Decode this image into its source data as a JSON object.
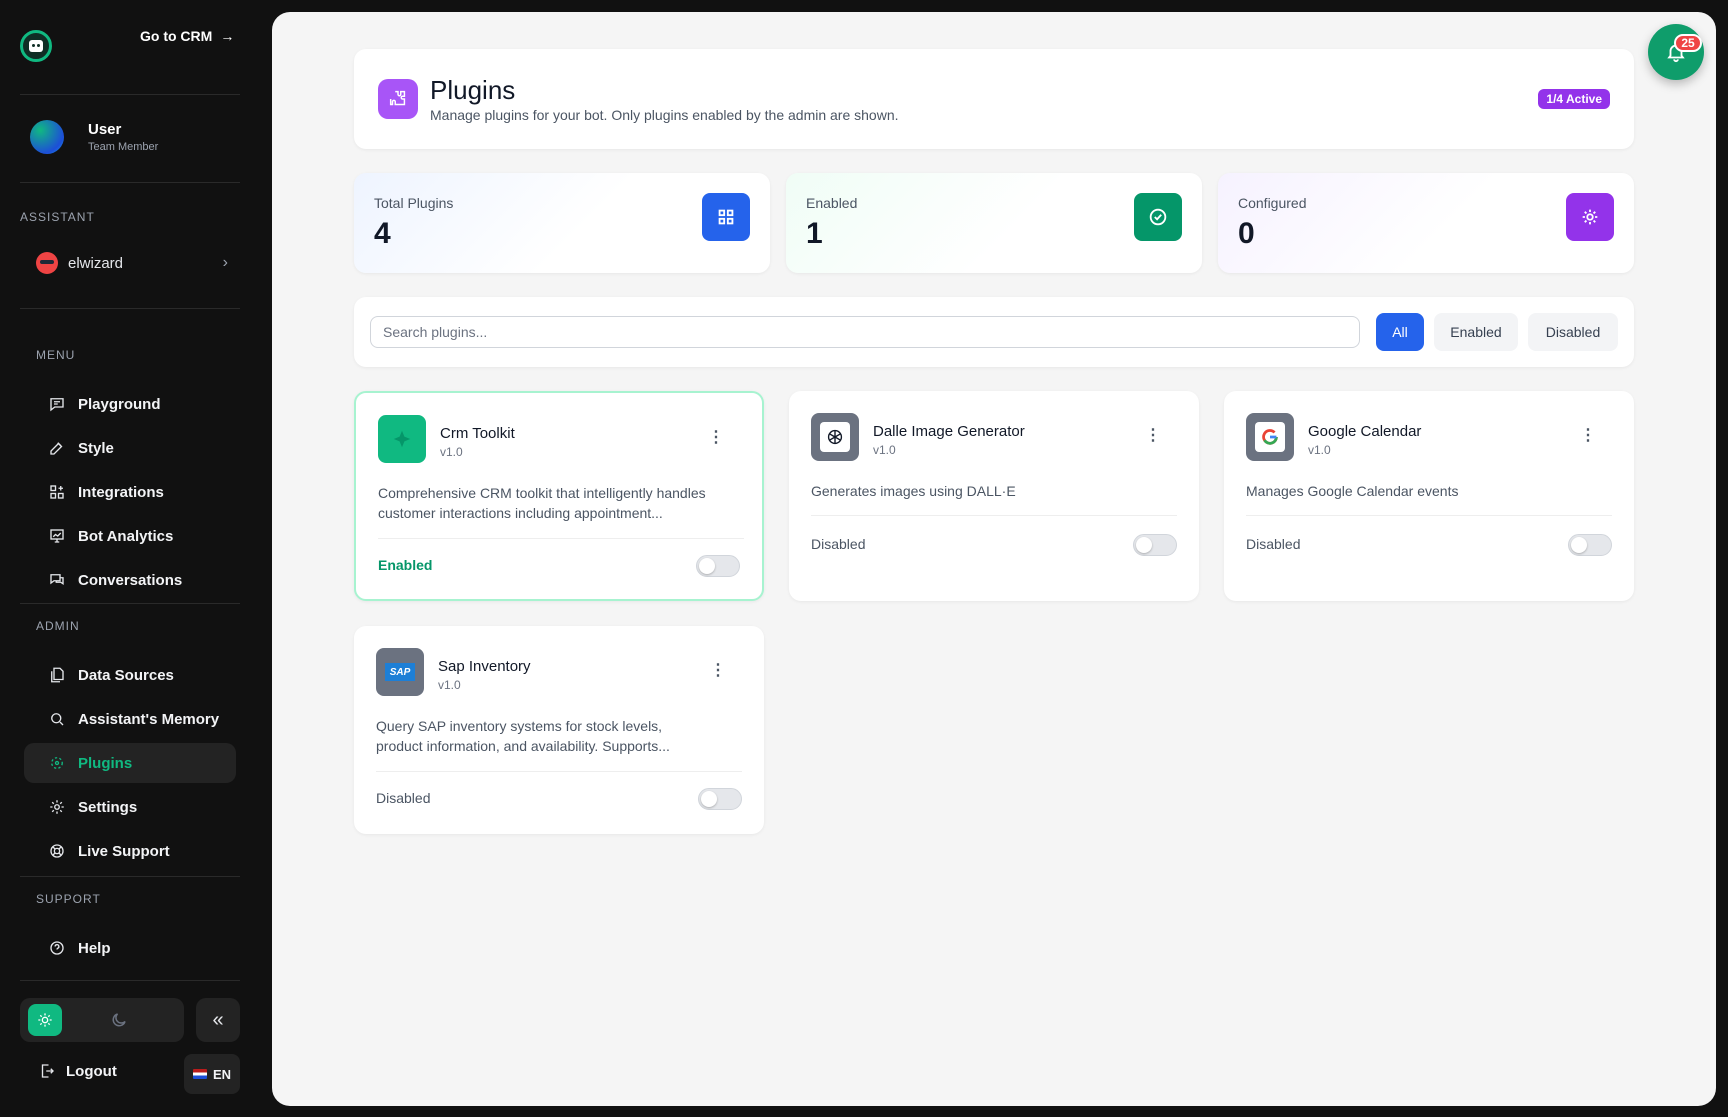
{
  "sidebar": {
    "goto_crm": "Go to CRM",
    "user": {
      "name": "User",
      "role": "Team Member"
    },
    "assistant_section": "ASSISTANT",
    "assistant_name": "elwizard",
    "menu_section": "MENU",
    "menu": [
      {
        "label": "Playground",
        "icon": "chat-bubble-icon"
      },
      {
        "label": "Style",
        "icon": "edit-icon"
      },
      {
        "label": "Integrations",
        "icon": "grid-plus-icon"
      },
      {
        "label": "Bot Analytics",
        "icon": "analytics-icon"
      },
      {
        "label": "Conversations",
        "icon": "conversations-icon"
      }
    ],
    "admin_section": "ADMIN",
    "admin": [
      {
        "label": "Data Sources",
        "icon": "documents-icon"
      },
      {
        "label": "Assistant's Memory",
        "icon": "search-icon"
      },
      {
        "label": "Plugins",
        "icon": "plugin-icon",
        "active": true
      },
      {
        "label": "Settings",
        "icon": "gear-icon"
      },
      {
        "label": "Live Support",
        "icon": "lifebuoy-icon"
      }
    ],
    "support_section": "SUPPORT",
    "support": [
      {
        "label": "Help",
        "icon": "help-icon"
      }
    ],
    "logout": "Logout",
    "language": "EN"
  },
  "notifications": {
    "count": "25"
  },
  "header": {
    "title": "Plugins",
    "subtitle": "Manage plugins for your bot. Only plugins enabled by the admin are shown.",
    "badge": "1/4 Active"
  },
  "stats": [
    {
      "label": "Total Plugins",
      "value": "4",
      "color": "#2563eb"
    },
    {
      "label": "Enabled",
      "value": "1",
      "color": "#059669"
    },
    {
      "label": "Configured",
      "value": "0",
      "color": "#9333ea"
    }
  ],
  "search": {
    "placeholder": "Search plugins..."
  },
  "filters": [
    "All",
    "Enabled",
    "Disabled"
  ],
  "plugins": [
    {
      "name": "Crm Toolkit",
      "version": "v1.0",
      "desc_line1": "Comprehensive CRM toolkit that intelligently handles",
      "desc_line2": "customer interactions including appointment...",
      "status": "Enabled",
      "enabled": false
    },
    {
      "name": "Dalle Image Generator",
      "version": "v1.0",
      "desc_line1": "Generates images using DALL·E",
      "desc_line2": "",
      "status": "Disabled",
      "enabled": false
    },
    {
      "name": "Google Calendar",
      "version": "v1.0",
      "desc_line1": "Manages Google Calendar events",
      "desc_line2": "",
      "status": "Disabled",
      "enabled": false
    },
    {
      "name": "Sap Inventory",
      "version": "v1.0",
      "desc_line1": "Query SAP inventory systems for stock levels,",
      "desc_line2": "product information, and availability. Supports...",
      "status": "Disabled",
      "enabled": false,
      "logo_text": "SAP"
    }
  ]
}
